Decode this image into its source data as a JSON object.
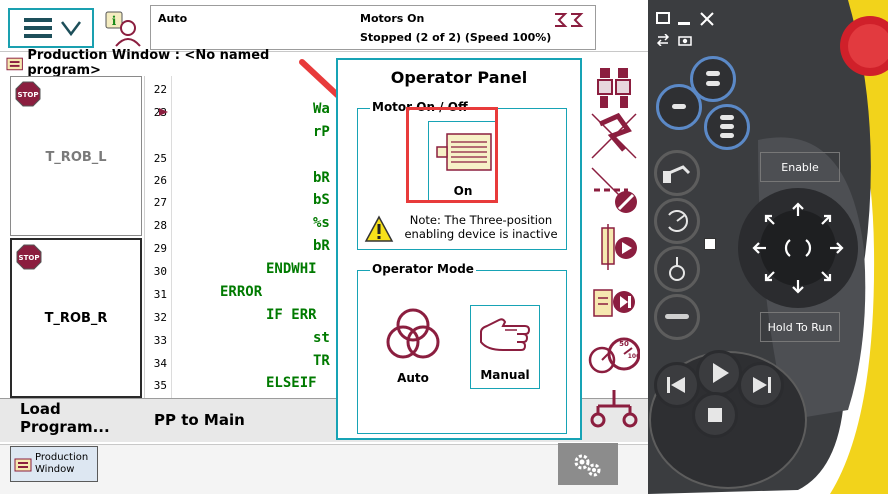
{
  "status": {
    "mode": "Auto",
    "motors": "Motors On",
    "state": "Stopped (2 of 2) (Speed 100%)"
  },
  "window": {
    "title": "Production Window : <No named program>"
  },
  "tasks": [
    {
      "name": "T_ROB_L",
      "stop_label": "STOP"
    },
    {
      "name": "T_ROB_R",
      "stop_label": "STOP"
    }
  ],
  "code": {
    "line_numbers": [
      "22",
      "23",
      "25",
      "26",
      "27",
      "28",
      "29",
      "30",
      "31",
      "32",
      "33",
      "34",
      "35"
    ],
    "lines": [
      "Wa",
      "rP",
      "",
      "bR",
      "bS",
      "%s",
      "bR",
      "ENDWHI",
      "ERROR",
      "IF ERR",
      "st",
      "TR",
      "ELSEIF"
    ]
  },
  "bottom": {
    "load_program": "Load\nProgram...",
    "pp_to_main": "PP to Main"
  },
  "taskbar": {
    "production_window_tab": "Production\nWindow"
  },
  "operator_panel": {
    "title": "Operator Panel",
    "motor_group_label": "Motor On / Off",
    "on_label": "On",
    "note": "Note: The Three-position enabling device is inactive",
    "mode_group_label": "Operator Mode",
    "auto_label": "Auto",
    "manual_label": "Manual"
  },
  "pendant": {
    "enable_label": "Enable",
    "hold_to_run_label": "Hold To Run"
  },
  "colors": {
    "accent_teal": "#17a3b5",
    "code_green": "#007a00",
    "highlight_red": "#e83b3b",
    "icon_maroon": "#8b1e3f",
    "pendant_blue": "#5b89c7",
    "estop_red": "#d0202a",
    "housing_yellow": "#f2d31b"
  }
}
